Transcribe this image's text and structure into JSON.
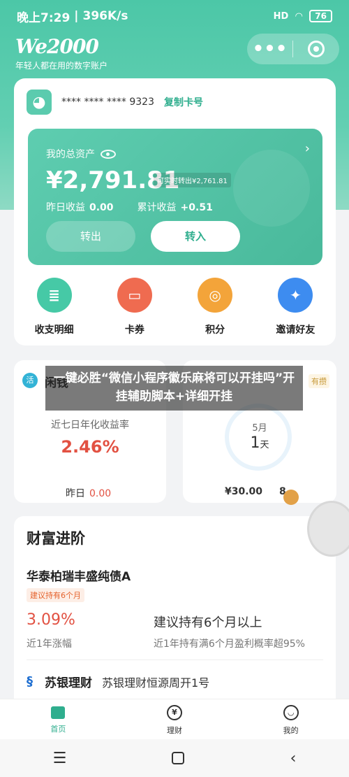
{
  "status": {
    "time": "晚上7:29",
    "speed": "396K/s",
    "net": "HD",
    "battery": "76"
  },
  "brand": {
    "logo": "We2000",
    "slogan": "年轻人都在用的数字账户"
  },
  "capsule": {
    "more": "•●•",
    "target": "target"
  },
  "account": {
    "masked": "**** **** **** 9323",
    "copy": "复制卡号"
  },
  "assets": {
    "label": "我的总资产",
    "amount": "¥2,791.81",
    "withdraw": "可实时转出¥2,761.81",
    "yesterday_label": "昨日收益",
    "yesterday": "0.00",
    "total_label": "累计收益",
    "total": "+0.51",
    "btn_out": "转出",
    "btn_in": "转入"
  },
  "quick": [
    {
      "label": "收支明细",
      "color": "#46c9a6",
      "glyph": "≣"
    },
    {
      "label": "卡券",
      "color": "#ef6b50",
      "glyph": "▭"
    },
    {
      "label": "积分",
      "color": "#f3a43a",
      "glyph": "◎"
    },
    {
      "label": "邀请好友",
      "color": "#3d8cf0",
      "glyph": "✦"
    }
  ],
  "card_left": {
    "badge": "活",
    "title": "闲钱",
    "sub": "近七日年化收益率",
    "rate": "2.46%",
    "foot_label": "昨日",
    "foot_value": "0.00"
  },
  "card_right": {
    "tag": "有攒",
    "month": "5月",
    "day": "1",
    "day_unit": "天",
    "foot": "¥30.00",
    "foot2": "8"
  },
  "overlay": {
    "text": "一键必胜“微信小程序徽乐麻将可以开挂吗”开挂辅助脚本+详细开挂"
  },
  "wealth": {
    "title": "财富进阶",
    "product": "华泰柏瑞丰盛纯债A",
    "tag": "建议持有6个月",
    "rate": "3.09%",
    "rate_label": "近1年涨幅",
    "hold": "建议持有6个月以上",
    "hold_label": "近1年持有满6个月盈利概率超95%",
    "bank_name": "苏银理财",
    "bank_product": "苏银理财恒源周开1号"
  },
  "tabs": [
    {
      "label": "首页",
      "icon": "home-icon"
    },
    {
      "label": "理财",
      "icon": "yen-icon"
    },
    {
      "label": "我的",
      "icon": "user-icon"
    }
  ],
  "nav": {
    "menu": "☰",
    "back": "‹"
  }
}
